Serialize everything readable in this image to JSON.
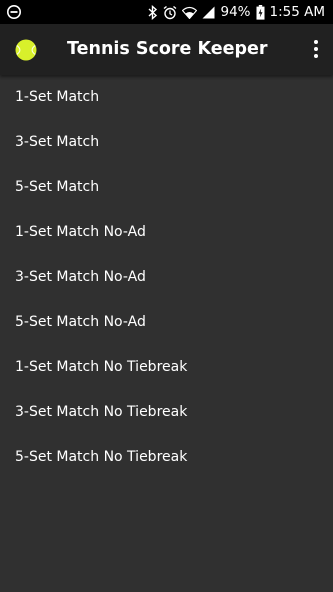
{
  "status_bar": {
    "dnd_icon": "do-not-disturb-icon",
    "icons": [
      "bluetooth-icon",
      "alarm-icon",
      "wifi-icon",
      "signal-icon"
    ],
    "battery_percent": "94%",
    "battery_icon": "battery-charging-icon",
    "time": "1:55 AM"
  },
  "app_bar": {
    "icon": "tennis-ball-icon",
    "title": "Tennis Score Keeper",
    "menu_icon": "more-vert-icon"
  },
  "matches": [
    "1-Set Match",
    "3-Set Match",
    "5-Set Match",
    "1-Set Match No-Ad",
    "3-Set Match No-Ad",
    "5-Set Match No-Ad",
    "1-Set Match No Tiebreak",
    "3-Set Match No Tiebreak",
    "5-Set Match No Tiebreak"
  ],
  "colors": {
    "status_bar": "#000000",
    "app_bar": "#212121",
    "background": "#303030",
    "tennis_ball": "#d8f02b",
    "text": "#ffffff"
  }
}
